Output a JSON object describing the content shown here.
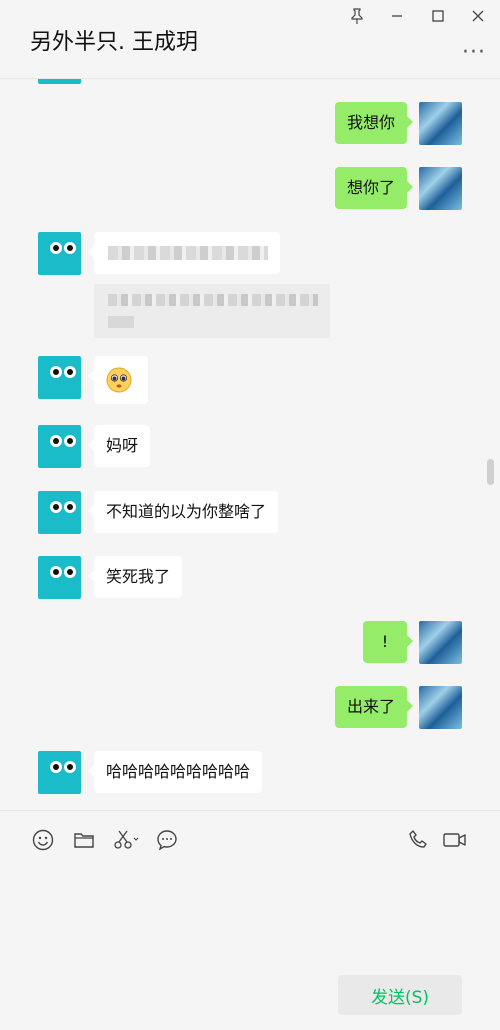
{
  "window": {
    "title": "另外半只. 王成玥",
    "controls": [
      "pin-icon",
      "minimize-icon",
      "maximize-icon",
      "close-icon"
    ],
    "more_label": "···"
  },
  "messages": [
    {
      "side": "right",
      "text": "我想你"
    },
    {
      "side": "right",
      "text": "想你了"
    },
    {
      "side": "left",
      "text": "",
      "note": "blurred"
    },
    {
      "side": "left",
      "text": "",
      "emoji": "pleading-face"
    },
    {
      "side": "left",
      "text": "妈呀"
    },
    {
      "side": "left",
      "text": "不知道的以为你整啥了"
    },
    {
      "side": "left",
      "text": "笑死我了"
    },
    {
      "side": "right",
      "text": "!"
    },
    {
      "side": "right",
      "text": "出来了"
    },
    {
      "side": "left",
      "text": "哈哈哈哈哈哈哈哈哈"
    }
  ],
  "toolbar": {
    "icons": [
      "emoji-icon",
      "folder-icon",
      "scissors-icon",
      "chat-history-icon",
      "phone-icon",
      "video-call-icon"
    ]
  },
  "input": {
    "send_label": "发送(S)"
  },
  "colors": {
    "bubble_self": "#95ec69",
    "bubble_other": "#ffffff",
    "accent": "#07c160",
    "avatar_other": "#1bbcc9"
  }
}
